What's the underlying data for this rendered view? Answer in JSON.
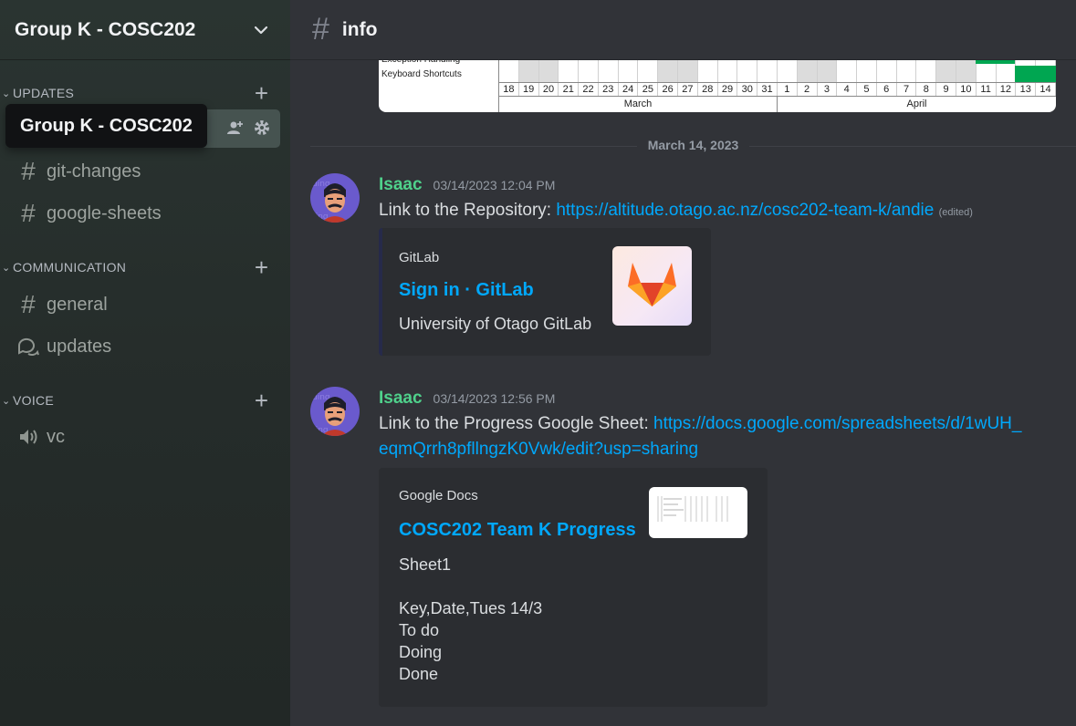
{
  "server": {
    "name": "Group K - COSC202"
  },
  "tooltip": {
    "text": "Group K - COSC202"
  },
  "sidebar": {
    "categories": [
      {
        "label": "UPDATES"
      },
      {
        "label": "COMMUNICATION"
      },
      {
        "label": "VOICE"
      }
    ],
    "channels": [
      {
        "label": "git-changes"
      },
      {
        "label": "google-sheets"
      },
      {
        "label": "general"
      },
      {
        "label": "updates"
      },
      {
        "label": "vc"
      }
    ]
  },
  "channel_header": {
    "title": "info"
  },
  "spreadsheet_preview": {
    "row_labels": [
      "Exception Handling",
      "Keyboard Shortcuts"
    ],
    "days": [
      "18",
      "19",
      "20",
      "21",
      "22",
      "23",
      "24",
      "25",
      "26",
      "27",
      "28",
      "29",
      "30",
      "31",
      "1",
      "2",
      "3",
      "4",
      "5",
      "6",
      "7",
      "8",
      "9",
      "10",
      "11",
      "12",
      "13",
      "14"
    ],
    "months": [
      "March",
      "April"
    ]
  },
  "date_divider": "March 14, 2023",
  "messages": [
    {
      "author": "Isaac",
      "timestamp": "03/14/2023 12:04 PM",
      "text": "Link to the Repository: ",
      "link": "https://altitude.otago.ac.nz/cosc202-team-k/andie",
      "edited": "(edited)",
      "embed": {
        "provider": "GitLab",
        "title": "Sign in · GitLab",
        "description": "University of Otago GitLab"
      }
    },
    {
      "author": "Isaac",
      "timestamp": "03/14/2023 12:56 PM",
      "text": "Link to the Progress Google Sheet: ",
      "link": "https://docs.google.com/spreadsheets/d/1wUH_",
      "link_cont": "eqmQrrh8pfllngzK0Vwk/edit?usp=sharing",
      "embed": {
        "provider": "Google Docs",
        "title": "COSC202 Team K Progress",
        "description": "Sheet1\n\nKey,Date,Tues 14/3\nTo do\nDoing\nDone"
      }
    }
  ],
  "colors": {
    "author": "#4fd18b",
    "link": "#00a8fc",
    "sidebar_active": "#465350"
  }
}
